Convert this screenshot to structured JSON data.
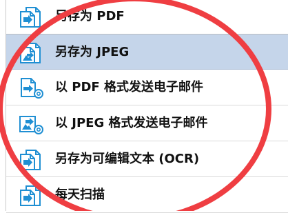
{
  "menu": {
    "items": [
      {
        "label": "另存为 PDF",
        "icon": "save-pdf-icon",
        "selected": false
      },
      {
        "label": "另存为 JPEG",
        "icon": "save-jpeg-icon",
        "selected": true
      },
      {
        "label": "以 PDF 格式发送电子邮件",
        "icon": "email-pdf-icon",
        "selected": false
      },
      {
        "label": "以 JPEG 格式发送电子邮件",
        "icon": "email-jpeg-icon",
        "selected": false
      },
      {
        "label": "另存为可编辑文本 (OCR)",
        "icon": "save-ocr-text-icon",
        "selected": false
      },
      {
        "label": "每天扫描",
        "icon": "daily-scan-icon",
        "selected": false
      }
    ]
  },
  "colors": {
    "selected_background": "#c5d5ea",
    "icon_blue": "#1f8fd3",
    "annotation_red": "#ef3e42"
  }
}
